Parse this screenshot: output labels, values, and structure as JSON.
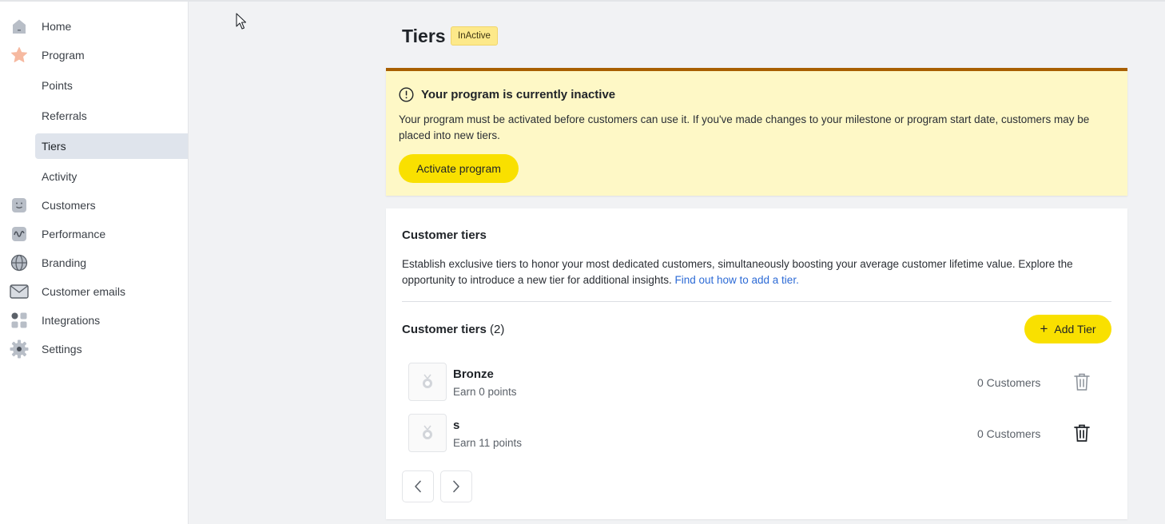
{
  "sidebar": {
    "items": [
      {
        "label": "Home",
        "icon": "home-icon"
      },
      {
        "label": "Program",
        "icon": "star-icon"
      },
      {
        "label": "Points"
      },
      {
        "label": "Referrals"
      },
      {
        "label": "Tiers",
        "active": true
      },
      {
        "label": "Activity"
      },
      {
        "label": "Customers",
        "icon": "smile-icon"
      },
      {
        "label": "Performance",
        "icon": "wave-icon"
      },
      {
        "label": "Branding",
        "icon": "globe-icon"
      },
      {
        "label": "Customer emails",
        "icon": "mail-icon"
      },
      {
        "label": "Integrations",
        "icon": "grid-icon"
      },
      {
        "label": "Settings",
        "icon": "gear-icon"
      }
    ]
  },
  "header": {
    "title": "Tiers",
    "status": "InActive"
  },
  "alert": {
    "title": "Your program is currently inactive",
    "body": "Your program must be activated before customers can use it. If you've made changes to your milestone or program start date, customers may be placed into new tiers.",
    "button": "Activate program"
  },
  "card": {
    "title": "Customer tiers",
    "description": "Establish exclusive tiers to honor your most dedicated customers, simultaneously boosting your average customer lifetime value. Explore the opportunity to introduce a new tier for additional insights.",
    "link": "Find out how to add a tier.",
    "list_heading": "Customer tiers",
    "list_count": "(2)",
    "add_button": "Add Tier",
    "tiers": [
      {
        "name": "Bronze",
        "points": "Earn 0 points",
        "customers": "0 Customers"
      },
      {
        "name": "s",
        "points": "Earn 11 points",
        "customers": "0 Customers"
      }
    ]
  },
  "colors": {
    "accent_yellow": "#f9e000",
    "alert_bg": "#fef8c6",
    "alert_border": "#a85f00",
    "link": "#2d6bd6"
  }
}
